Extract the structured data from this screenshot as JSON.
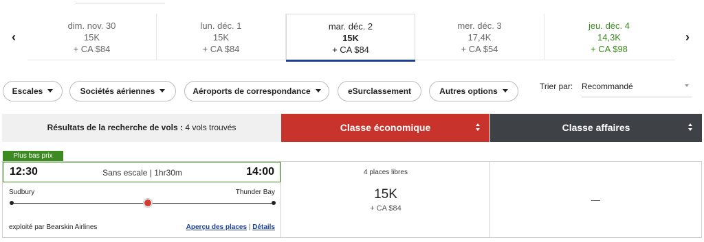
{
  "date_strip": {
    "prev_icon": "chevron-left-icon",
    "next_icon": "chevron-right-icon",
    "prev_glyph": "‹",
    "next_glyph": "›",
    "dates": [
      {
        "label": "dim. nov. 30",
        "points": "15K",
        "tax": "+ CA $84"
      },
      {
        "label": "lun. déc. 1",
        "points": "15K",
        "tax": "+ CA $84"
      },
      {
        "label": "mar. déc. 2",
        "points": "15K",
        "tax": "+ CA $84"
      },
      {
        "label": "mer. déc. 3",
        "points": "17,4K",
        "tax": "+ CA $54"
      },
      {
        "label": "jeu. déc. 4",
        "points": "14,3K",
        "tax": "+ CA $98"
      }
    ],
    "selected_index": 2,
    "cheapest_color": "#3a8a1d",
    "selected_underline_color": "#1c3f94"
  },
  "filters": {
    "stops": "Escales",
    "airlines": "Sociétés aériennes",
    "connecting_airports": "Aéroports de correspondance",
    "upgrade": "eSurclassement",
    "more_options": "Autres options",
    "sort_label": "Trier par:",
    "sort_value": "Recommandé"
  },
  "results": {
    "summary_bold": "Résultats de la recherche de vols :",
    "summary_count": " 4 vols trouvés",
    "economy_label": "Classe économique",
    "business_label": "Classe affaires",
    "economy_color": "#c8332b",
    "business_color": "#3e4247"
  },
  "flight": {
    "badge": "Plus bas prix",
    "badge_color": "#3d8a23",
    "departure_time": "12:30",
    "arrival_time": "14:00",
    "stops_duration": "Sans escale | 1hr30m",
    "origin": "Sudbury",
    "destination": "Thunder Bay",
    "operator": "exploité par Bearskin Airlines",
    "seat_map_link": "Aperçu des places",
    "separator": "|",
    "details_link": "Détails",
    "economy": {
      "seats": "4 places libres",
      "points": "15K",
      "tax": "+ CA $84"
    },
    "business": {
      "value": "—"
    }
  }
}
